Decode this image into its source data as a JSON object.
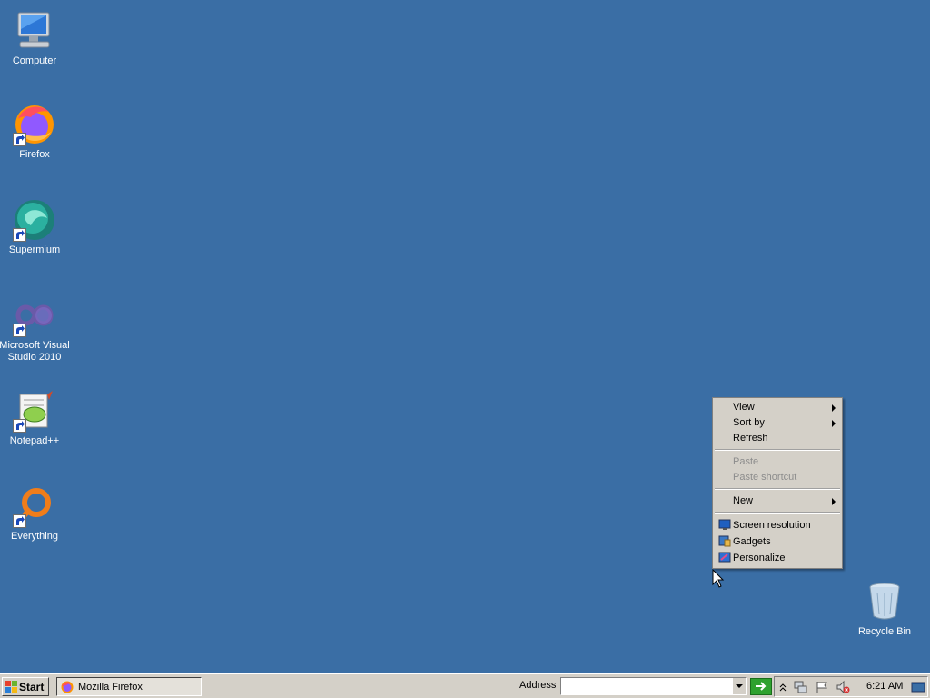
{
  "desktop": {
    "icons": [
      {
        "label": "Computer",
        "icon": "computer-icon"
      },
      {
        "label": "Firefox",
        "icon": "firefox-icon"
      },
      {
        "label": "Supermium",
        "icon": "supermium-icon"
      },
      {
        "label": "Microsoft Visual Studio 2010",
        "icon": "visual-studio-icon"
      },
      {
        "label": "Notepad++",
        "icon": "notepadpp-icon"
      },
      {
        "label": "Everything",
        "icon": "everything-icon"
      }
    ],
    "recycle_bin": {
      "label": "Recycle Bin",
      "icon": "recycle-bin-icon"
    },
    "background_color": "#3a6ea5"
  },
  "context_menu": {
    "items": [
      {
        "label": "View",
        "submenu": true
      },
      {
        "label": "Sort by",
        "submenu": true
      },
      {
        "label": "Refresh"
      },
      {
        "label": "Paste",
        "disabled": true
      },
      {
        "label": "Paste shortcut",
        "disabled": true
      },
      {
        "label": "New",
        "submenu": true
      },
      {
        "label": "Screen resolution",
        "icon": "screen-resolution-icon"
      },
      {
        "label": "Gadgets",
        "icon": "gadgets-icon"
      },
      {
        "label": "Personalize",
        "icon": "personalize-icon"
      }
    ]
  },
  "taskbar": {
    "start_label": "Start",
    "task_button": {
      "label": "Mozilla Firefox",
      "icon": "firefox-icon"
    },
    "address_label": "Address",
    "address_value": "",
    "clock": "6:21 AM",
    "tray_icons": [
      "chevron-up-icon",
      "network-icon",
      "flag-icon",
      "volume-muted-icon",
      "show-desktop-icon"
    ]
  }
}
